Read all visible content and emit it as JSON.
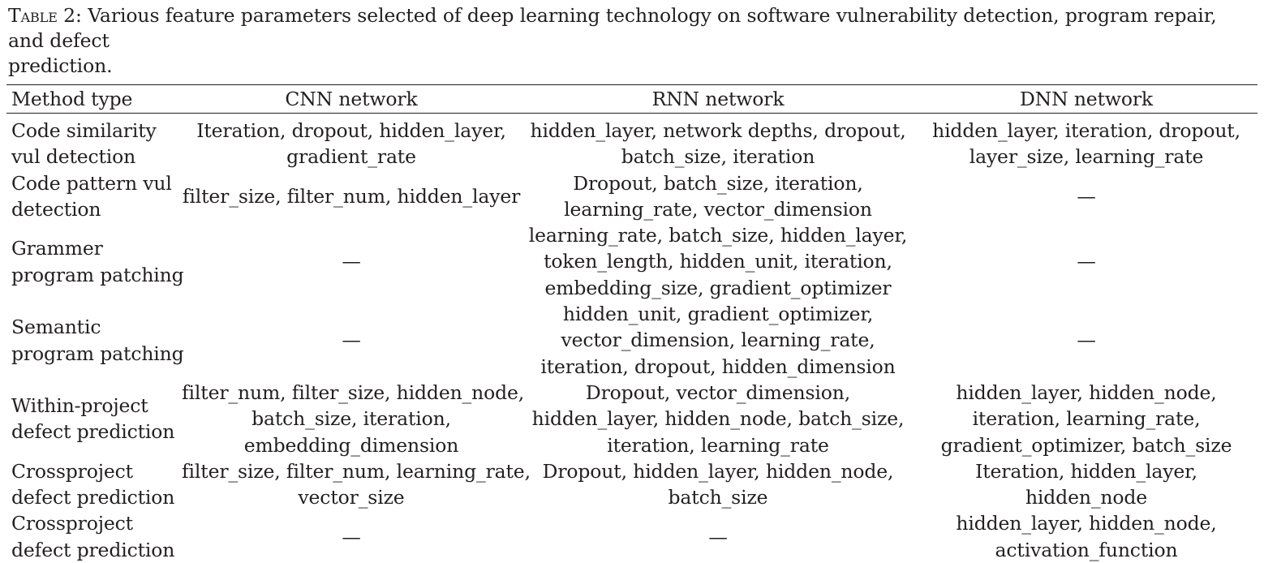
{
  "caption": {
    "label": "Table 2:",
    "text_line1": " Various feature parameters selected of deep learning technology on software vulnerability detection, program repair, and defect",
    "text_line2": "prediction."
  },
  "table": {
    "headers": [
      "Method type",
      "CNN network",
      "RNN network",
      "DNN network"
    ],
    "rows": [
      {
        "method": [
          "Code similarity",
          "vul detection"
        ],
        "cnn": [
          "Iteration, dropout, hidden_layer,",
          "gradient_rate"
        ],
        "rnn": [
          "hidden_layer, network depths, dropout,",
          "batch_size, iteration"
        ],
        "dnn": [
          "hidden_layer, iteration, dropout,",
          "layer_size, learning_rate"
        ]
      },
      {
        "method": [
          "Code pattern vul",
          "detection"
        ],
        "cnn": [
          "filter_size, filter_num, hidden_layer"
        ],
        "rnn": [
          "Dropout, batch_size, iteration,",
          "learning_rate, vector_dimension"
        ],
        "dnn": [
          "—"
        ]
      },
      {
        "method": [
          "Grammer",
          "program patching"
        ],
        "cnn": [
          "—"
        ],
        "rnn": [
          "learning_rate, batch_size, hidden_layer,",
          "token_length, hidden_unit, iteration,",
          "embedding_size, gradient_optimizer"
        ],
        "dnn": [
          "—"
        ]
      },
      {
        "method": [
          "Semantic",
          "program patching"
        ],
        "cnn": [
          "—"
        ],
        "rnn": [
          "hidden_unit, gradient_optimizer,",
          "vector_dimension, learning_rate,",
          "iteration, dropout, hidden_dimension"
        ],
        "dnn": [
          "—"
        ]
      },
      {
        "method": [
          "Within-project",
          "defect prediction"
        ],
        "cnn": [
          "filter_num, filter_size, hidden_node,",
          "batch_size, iteration,",
          "embedding_dimension"
        ],
        "rnn": [
          "Dropout, vector_dimension,",
          "hidden_layer, hidden_node, batch_size,",
          "iteration, learning_rate"
        ],
        "dnn": [
          "hidden_layer, hidden_node,",
          "iteration, learning_rate,",
          "gradient_optimizer, batch_size"
        ]
      },
      {
        "method": [
          "Crossproject",
          "defect prediction"
        ],
        "cnn": [
          "filter_size, filter_num, learning_rate,",
          "vector_size"
        ],
        "rnn": [
          "Dropout, hidden_layer, hidden_node,",
          "batch_size"
        ],
        "dnn": [
          "Iteration, hidden_layer,",
          "hidden_node"
        ]
      },
      {
        "method": [
          "Crossproject",
          "defect prediction"
        ],
        "cnn": [
          "—"
        ],
        "rnn": [
          "—"
        ],
        "dnn": [
          "hidden_layer, hidden_node,",
          "activation_function"
        ]
      }
    ]
  }
}
